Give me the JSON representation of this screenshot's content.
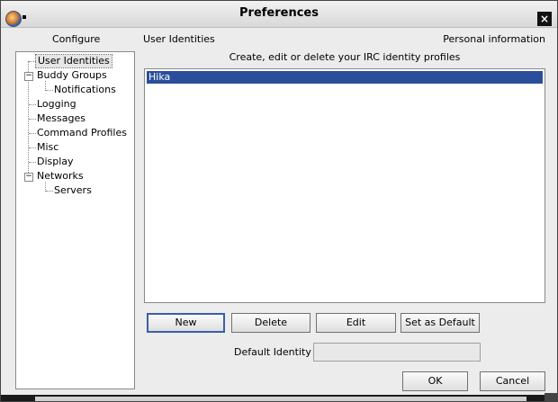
{
  "window": {
    "title": "Preferences"
  },
  "sidebar": {
    "header": "Configure",
    "items": [
      {
        "label": "User Identities"
      },
      {
        "label": "Buddy Groups"
      },
      {
        "label": "Notifications"
      },
      {
        "label": "Logging"
      },
      {
        "label": "Messages"
      },
      {
        "label": "Command Profiles"
      },
      {
        "label": "Misc"
      },
      {
        "label": "Display"
      },
      {
        "label": "Networks"
      },
      {
        "label": "Servers"
      }
    ],
    "expander_symbol": "−"
  },
  "main": {
    "section_title": "User Identities",
    "section_subtitle": "Personal information",
    "description": "Create, edit or delete your IRC identity profiles",
    "identities": [
      "Hika"
    ],
    "buttons": {
      "new": "New",
      "delete": "Delete",
      "edit": "Edit",
      "set_default": "Set as Default"
    },
    "default_identity_label": "Default Identity",
    "default_identity_value": ""
  },
  "footer": {
    "ok": "OK",
    "cancel": "Cancel"
  },
  "icons": {
    "close": "×"
  },
  "colors": {
    "selection": "#2b4e9a",
    "titlebar": "#e4e4e4"
  }
}
